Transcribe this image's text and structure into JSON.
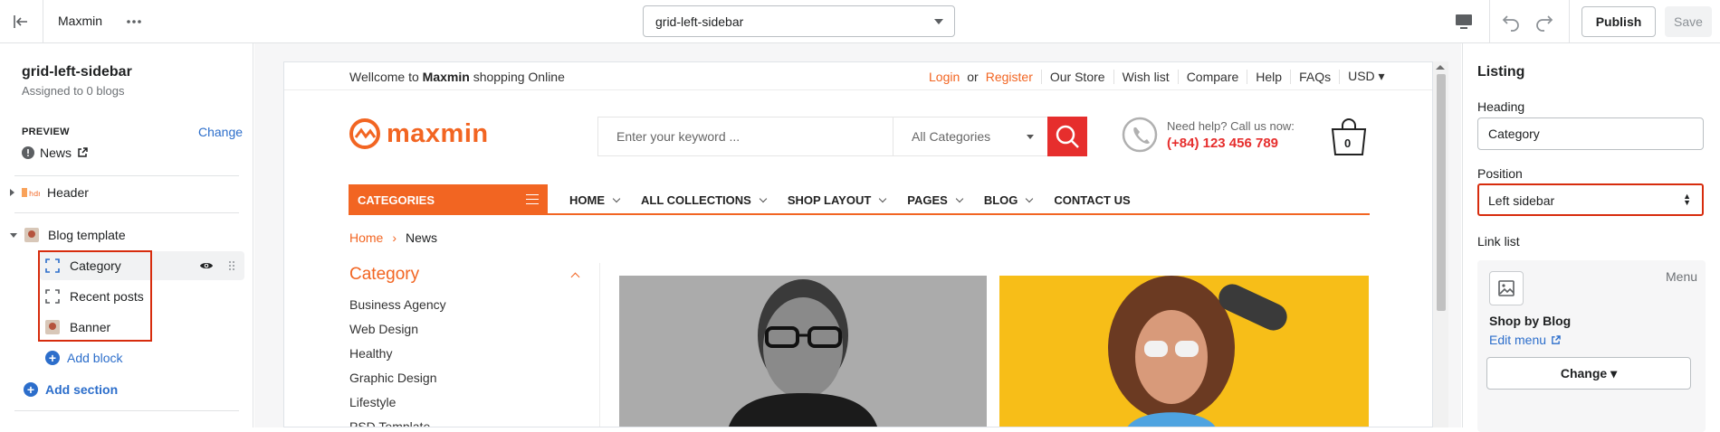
{
  "topbar": {
    "store_name": "Maxmin",
    "template_select": "grid-left-sidebar",
    "publish_label": "Publish",
    "save_label": "Save"
  },
  "left_panel": {
    "template_name": "grid-left-sidebar",
    "assigned": "Assigned to 0 blogs",
    "preview_label": "PREVIEW",
    "change_label": "Change",
    "preview_page": "News",
    "sections": [
      {
        "label": "Header",
        "icon": "header-section-icon"
      },
      {
        "label": "Blog template",
        "icon": "blog-template-icon"
      }
    ],
    "blocks": [
      {
        "label": "Category",
        "icon": "block-dashed-icon"
      },
      {
        "label": "Recent posts",
        "icon": "block-dashed-icon"
      },
      {
        "label": "Banner",
        "icon": "image-thumb-icon"
      }
    ],
    "add_block": "Add block",
    "add_section": "Add section"
  },
  "store": {
    "welcome_prefix": "Wellcome to",
    "welcome_brand": "Maxmin",
    "welcome_suffix": "shopping Online",
    "login": "Login",
    "or": "or",
    "register": "Register",
    "top_links": [
      "Our Store",
      "Wish list",
      "Compare",
      "Help",
      "FAQs"
    ],
    "currency": "USD",
    "logo_text": "maxmin",
    "search_placeholder": "Enter your keyword ...",
    "search_category": "All Categories",
    "help_line1": "Need help? Call us now:",
    "help_phone": "(+84) 123 456 789",
    "cart_count": "0",
    "categories_label": "CATEGORIES",
    "menu": [
      {
        "label": "HOME",
        "dropdown": true
      },
      {
        "label": "ALL COLLECTIONS",
        "dropdown": true
      },
      {
        "label": "SHOP LAYOUT",
        "dropdown": true
      },
      {
        "label": "PAGES",
        "dropdown": true
      },
      {
        "label": "BLOG",
        "dropdown": true
      },
      {
        "label": "CONTACT US",
        "dropdown": false
      }
    ],
    "breadcrumb_home": "Home",
    "breadcrumb_current": "News",
    "category_heading": "Category",
    "category_list": [
      "Business Agency",
      "Web Design",
      "Healthy",
      "Graphic Design",
      "Lifestyle",
      "PSD Template"
    ]
  },
  "right_panel": {
    "title": "Listing",
    "heading_label": "Heading",
    "heading_value": "Category",
    "position_label": "Position",
    "position_value": "Left sidebar",
    "link_list_label": "Link list",
    "menu_label": "Menu",
    "shop_by_blog": "Shop by Blog",
    "edit_menu": "Edit menu",
    "change_label": "Change"
  },
  "colors": {
    "accent_orange": "#f26522",
    "search_red": "#e62e2d",
    "highlight_red": "#d72c0d",
    "link_blue": "#2c6ecb"
  }
}
